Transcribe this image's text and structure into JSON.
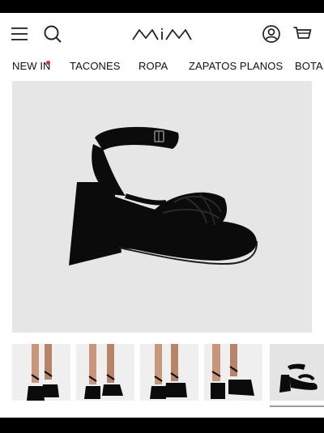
{
  "header": {
    "logo_text": "MIM",
    "icons": {
      "menu": "hamburger-menu-icon",
      "search": "search-icon",
      "account": "user-account-icon",
      "cart": "shopping-cart-icon"
    }
  },
  "nav": {
    "items": [
      {
        "label": "NEW IN",
        "badge": "red-dot"
      },
      {
        "label": "TACONES"
      },
      {
        "label": "ROPA"
      },
      {
        "label": "ZAPATOS PLANOS"
      },
      {
        "label": "BOTAS"
      }
    ]
  },
  "product": {
    "main_image": "black-platform-knotted-strap-heeled-sandal",
    "thumbnails": [
      "model-wearing-sandal-side-view",
      "model-wearing-sandal-front-view",
      "model-wearing-sandal-three-quarter-view",
      "model-wearing-sandal-walking-view",
      "sandal-product-only-view"
    ],
    "selected_thumbnail_index": 4
  },
  "colors": {
    "background": "#ffffff",
    "image_background": "#e6e6e6",
    "accent_dot": "#e3262b",
    "text": "#111111",
    "product": "#0b0b0b"
  }
}
